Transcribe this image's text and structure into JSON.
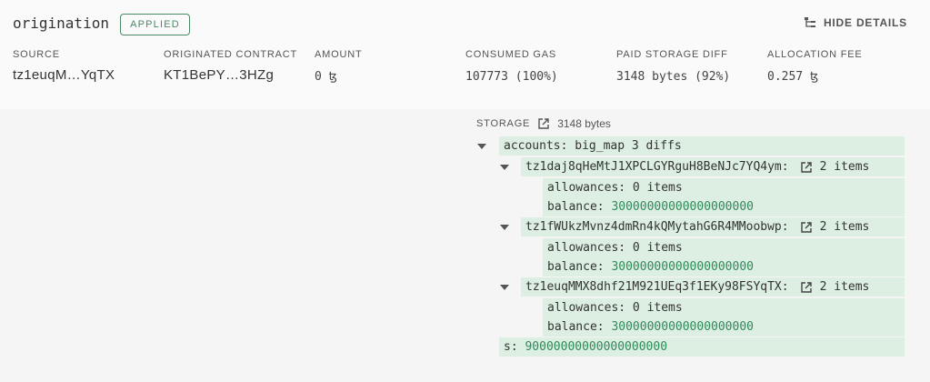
{
  "operation": {
    "kind": "origination",
    "status": "APPLIED",
    "hide_details": "HIDE DETAILS"
  },
  "fields": {
    "source": {
      "label": "SOURCE",
      "value": "tz1euqM…YqTX"
    },
    "contract": {
      "label": "ORIGINATED CONTRACT",
      "value": "KT1BePY…3HZg"
    },
    "amount": {
      "label": "AMOUNT",
      "value": "0 ꜩ"
    },
    "gas": {
      "label": "CONSUMED GAS",
      "value": "107773 (100%)"
    },
    "storage_diff": {
      "label": "PAID STORAGE DIFF",
      "value": "3148 bytes (92%)"
    },
    "allocation": {
      "label": "ALLOCATION FEE",
      "value": "0.257 ꜩ"
    }
  },
  "storage": {
    "label": "STORAGE",
    "size": "3148 bytes",
    "accounts": {
      "key": "accounts:",
      "type": "big_map 3 diffs"
    },
    "entries": [
      {
        "address": "tz1daj8qHeMtJ1XPCLGYRguH8BeNJc7YQ4ym:",
        "items": "2 items",
        "allowances_key": "allowances:",
        "allowances_val": "0 items",
        "balance_key": "balance:",
        "balance_val": "30000000000000000000"
      },
      {
        "address": "tz1fWUkzMvnz4dmRn4kQMytahG6R4MMoobwp:",
        "items": "2 items",
        "allowances_key": "allowances:",
        "allowances_val": "0 items",
        "balance_key": "balance:",
        "balance_val": "30000000000000000000"
      },
      {
        "address": "tz1euqMMX8dhf21M921UEq3f1EKy98FSYqTX:",
        "items": "2 items",
        "allowances_key": "allowances:",
        "allowances_val": "0 items",
        "balance_key": "balance:",
        "balance_val": "30000000000000000000"
      }
    ],
    "supply": {
      "key": "s:",
      "value": "90000000000000000000"
    }
  },
  "colors": {
    "accent": "#4a8a66",
    "row_bg": "#dcefe2",
    "value_green": "#2f8a5a"
  }
}
